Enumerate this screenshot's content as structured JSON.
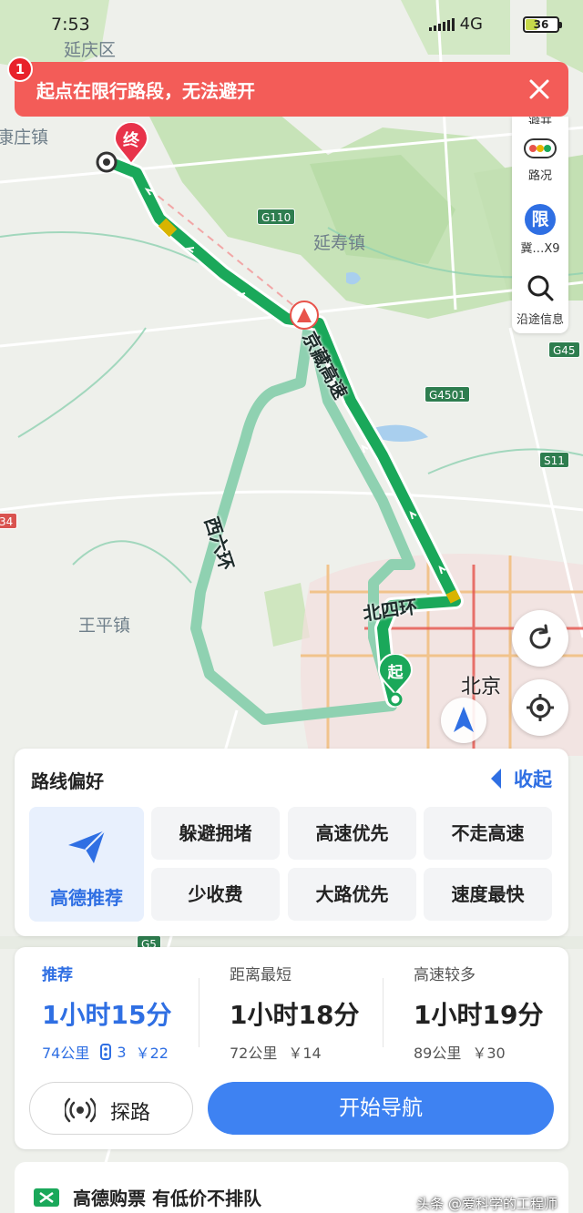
{
  "status_bar": {
    "time": "7:53",
    "network": "4G",
    "battery": "36"
  },
  "alert": {
    "badge": "1",
    "message": "起点在限行路段，无法避开"
  },
  "map": {
    "places": {
      "yanqing": "延庆区",
      "kangzhuang": "康庄镇",
      "yanshou": "延寿镇",
      "wangping": "王平镇",
      "beijing": "北京"
    },
    "road_shields": {
      "g110": "G110",
      "g45": "G45",
      "g4501": "G4501",
      "s11": "S11",
      "g5": "G5",
      "left_edge": "34"
    },
    "road_labels": {
      "jingzang": "京藏高速",
      "xiliuhuan": "西六环",
      "beisihuan": "北四环"
    },
    "markers": {
      "end": "终",
      "start": "起"
    }
  },
  "tools": {
    "partial_top": "避开",
    "traffic": "路况",
    "restriction_badge": "限",
    "restriction": "冀…X9",
    "along_route": "沿途信息"
  },
  "preferences": {
    "title": "路线偏好",
    "collapse": "收起",
    "recommended": "高德推荐",
    "options": [
      "躲避拥堵",
      "高速优先",
      "不走高速",
      "少收费",
      "大路优先",
      "速度最快"
    ]
  },
  "routes": [
    {
      "tag": "推荐",
      "duration": "1小时15分",
      "distance": "74公里",
      "lights": "3",
      "toll": "￥22"
    },
    {
      "tag": "距离最短",
      "duration": "1小时18分",
      "distance": "72公里",
      "toll": "￥14"
    },
    {
      "tag": "高速较多",
      "duration": "1小时19分",
      "distance": "89公里",
      "toll": "￥30"
    }
  ],
  "actions": {
    "explore": "探路",
    "navigate": "开始导航"
  },
  "promo": {
    "text": "高德购票 有低价不排队"
  },
  "watermark": "头条 @爱科学的工程师",
  "colors": {
    "route_main": "#1aa85a",
    "route_alt": "#8fd1b1",
    "accent": "#2f6fe3",
    "alert": "#f35c58"
  }
}
